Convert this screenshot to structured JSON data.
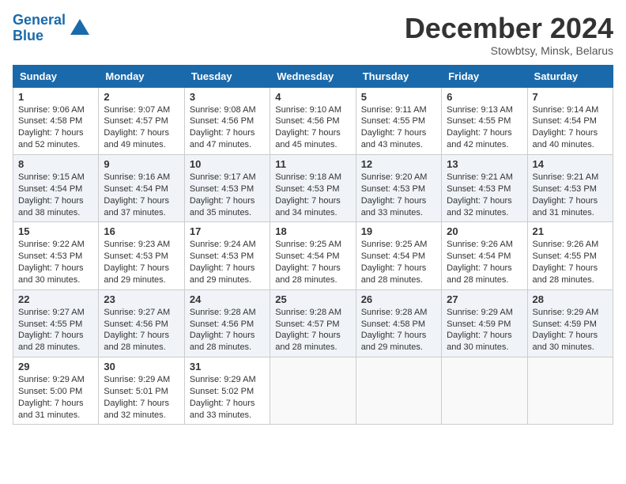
{
  "header": {
    "logo_line1": "General",
    "logo_line2": "Blue",
    "month_title": "December 2024",
    "subtitle": "Stowbtsy, Minsk, Belarus"
  },
  "weekdays": [
    "Sunday",
    "Monday",
    "Tuesday",
    "Wednesday",
    "Thursday",
    "Friday",
    "Saturday"
  ],
  "weeks": [
    [
      {
        "day": "1",
        "sunrise": "9:06 AM",
        "sunset": "4:58 PM",
        "daylight": "7 hours and 52 minutes."
      },
      {
        "day": "2",
        "sunrise": "9:07 AM",
        "sunset": "4:57 PM",
        "daylight": "7 hours and 49 minutes."
      },
      {
        "day": "3",
        "sunrise": "9:08 AM",
        "sunset": "4:56 PM",
        "daylight": "7 hours and 47 minutes."
      },
      {
        "day": "4",
        "sunrise": "9:10 AM",
        "sunset": "4:56 PM",
        "daylight": "7 hours and 45 minutes."
      },
      {
        "day": "5",
        "sunrise": "9:11 AM",
        "sunset": "4:55 PM",
        "daylight": "7 hours and 43 minutes."
      },
      {
        "day": "6",
        "sunrise": "9:13 AM",
        "sunset": "4:55 PM",
        "daylight": "7 hours and 42 minutes."
      },
      {
        "day": "7",
        "sunrise": "9:14 AM",
        "sunset": "4:54 PM",
        "daylight": "7 hours and 40 minutes."
      }
    ],
    [
      {
        "day": "8",
        "sunrise": "9:15 AM",
        "sunset": "4:54 PM",
        "daylight": "7 hours and 38 minutes."
      },
      {
        "day": "9",
        "sunrise": "9:16 AM",
        "sunset": "4:54 PM",
        "daylight": "7 hours and 37 minutes."
      },
      {
        "day": "10",
        "sunrise": "9:17 AM",
        "sunset": "4:53 PM",
        "daylight": "7 hours and 35 minutes."
      },
      {
        "day": "11",
        "sunrise": "9:18 AM",
        "sunset": "4:53 PM",
        "daylight": "7 hours and 34 minutes."
      },
      {
        "day": "12",
        "sunrise": "9:20 AM",
        "sunset": "4:53 PM",
        "daylight": "7 hours and 33 minutes."
      },
      {
        "day": "13",
        "sunrise": "9:21 AM",
        "sunset": "4:53 PM",
        "daylight": "7 hours and 32 minutes."
      },
      {
        "day": "14",
        "sunrise": "9:21 AM",
        "sunset": "4:53 PM",
        "daylight": "7 hours and 31 minutes."
      }
    ],
    [
      {
        "day": "15",
        "sunrise": "9:22 AM",
        "sunset": "4:53 PM",
        "daylight": "7 hours and 30 minutes."
      },
      {
        "day": "16",
        "sunrise": "9:23 AM",
        "sunset": "4:53 PM",
        "daylight": "7 hours and 29 minutes."
      },
      {
        "day": "17",
        "sunrise": "9:24 AM",
        "sunset": "4:53 PM",
        "daylight": "7 hours and 29 minutes."
      },
      {
        "day": "18",
        "sunrise": "9:25 AM",
        "sunset": "4:54 PM",
        "daylight": "7 hours and 28 minutes."
      },
      {
        "day": "19",
        "sunrise": "9:25 AM",
        "sunset": "4:54 PM",
        "daylight": "7 hours and 28 minutes."
      },
      {
        "day": "20",
        "sunrise": "9:26 AM",
        "sunset": "4:54 PM",
        "daylight": "7 hours and 28 minutes."
      },
      {
        "day": "21",
        "sunrise": "9:26 AM",
        "sunset": "4:55 PM",
        "daylight": "7 hours and 28 minutes."
      }
    ],
    [
      {
        "day": "22",
        "sunrise": "9:27 AM",
        "sunset": "4:55 PM",
        "daylight": "7 hours and 28 minutes."
      },
      {
        "day": "23",
        "sunrise": "9:27 AM",
        "sunset": "4:56 PM",
        "daylight": "7 hours and 28 minutes."
      },
      {
        "day": "24",
        "sunrise": "9:28 AM",
        "sunset": "4:56 PM",
        "daylight": "7 hours and 28 minutes."
      },
      {
        "day": "25",
        "sunrise": "9:28 AM",
        "sunset": "4:57 PM",
        "daylight": "7 hours and 28 minutes."
      },
      {
        "day": "26",
        "sunrise": "9:28 AM",
        "sunset": "4:58 PM",
        "daylight": "7 hours and 29 minutes."
      },
      {
        "day": "27",
        "sunrise": "9:29 AM",
        "sunset": "4:59 PM",
        "daylight": "7 hours and 30 minutes."
      },
      {
        "day": "28",
        "sunrise": "9:29 AM",
        "sunset": "4:59 PM",
        "daylight": "7 hours and 30 minutes."
      }
    ],
    [
      {
        "day": "29",
        "sunrise": "9:29 AM",
        "sunset": "5:00 PM",
        "daylight": "7 hours and 31 minutes."
      },
      {
        "day": "30",
        "sunrise": "9:29 AM",
        "sunset": "5:01 PM",
        "daylight": "7 hours and 32 minutes."
      },
      {
        "day": "31",
        "sunrise": "9:29 AM",
        "sunset": "5:02 PM",
        "daylight": "7 hours and 33 minutes."
      },
      null,
      null,
      null,
      null
    ]
  ]
}
